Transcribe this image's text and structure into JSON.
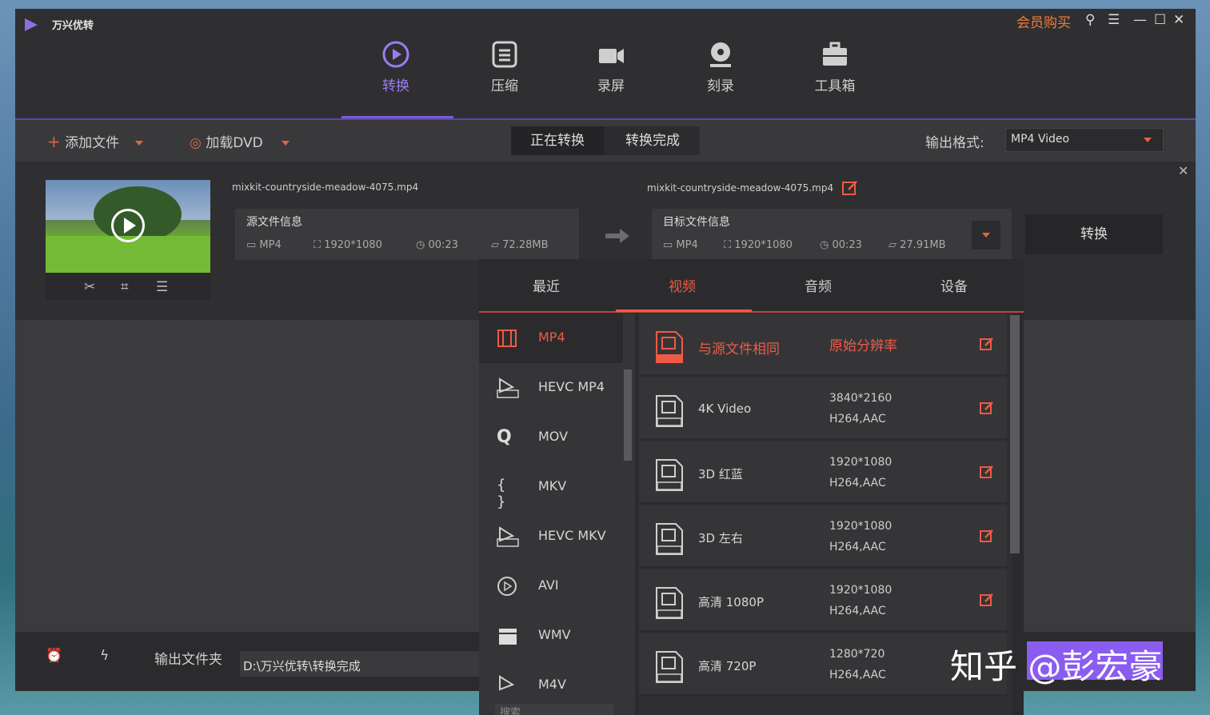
{
  "app": {
    "name": "万兴优转",
    "vip": "会员购买"
  },
  "nav": [
    {
      "label": "转换",
      "icon": "convert-icon",
      "active": true
    },
    {
      "label": "压缩",
      "icon": "compress-icon"
    },
    {
      "label": "录屏",
      "icon": "camera-icon"
    },
    {
      "label": "刻录",
      "icon": "disc-icon"
    },
    {
      "label": "工具箱",
      "icon": "toolbox-icon"
    }
  ],
  "toolbar": {
    "add_file": "添加文件",
    "load_dvd": "加载DVD",
    "seg_converting": "正在转换",
    "seg_done": "转换完成",
    "output_format_label": "输出格式:",
    "output_format_value": "MP4 Video"
  },
  "file": {
    "source_name": "mixkit-countryside-meadow-4075.mp4",
    "target_name": "mixkit-countryside-meadow-4075.mp4",
    "source": {
      "title": "源文件信息",
      "format": "MP4",
      "resolution": "1920*1080",
      "duration": "00:23",
      "size": "72.28MB"
    },
    "target": {
      "title": "目标文件信息",
      "format": "MP4",
      "resolution": "1920*1080",
      "duration": "00:23",
      "size": "27.91MB"
    },
    "convert_button": "转换"
  },
  "bottom": {
    "output_folder_label": "输出文件夹",
    "output_path": "D:\\万兴优转\\转换完成"
  },
  "panel": {
    "tabs": [
      "最近",
      "视频",
      "音频",
      "设备"
    ],
    "active_tab": 1,
    "formats": [
      {
        "label": "MP4",
        "selected": true
      },
      {
        "label": "HEVC MP4"
      },
      {
        "label": "MOV"
      },
      {
        "label": "MKV"
      },
      {
        "label": "HEVC MKV"
      },
      {
        "label": "AVI"
      },
      {
        "label": "WMV"
      },
      {
        "label": "M4V"
      }
    ],
    "presets": [
      {
        "name": "与源文件相同",
        "res": "原始分辨率",
        "codec": "",
        "tag": "SOURCE",
        "selected": true
      },
      {
        "name": "4K Video",
        "res": "3840*2160",
        "codec": "H264,AAC",
        "tag": "4K"
      },
      {
        "name": "3D 红蓝",
        "res": "1920*1080",
        "codec": "H264,AAC",
        "tag": "3D RB"
      },
      {
        "name": "3D 左右",
        "res": "1920*1080",
        "codec": "H264,AAC",
        "tag": "3D LR"
      },
      {
        "name": "高清 1080P",
        "res": "1920*1080",
        "codec": "H264,AAC",
        "tag": "1080P"
      },
      {
        "name": "高清 720P",
        "res": "1280*720",
        "codec": "H264,AAC",
        "tag": "720P"
      }
    ],
    "search_placeholder": "搜索"
  },
  "watermark": {
    "text": "知乎 @彭宏豪"
  },
  "colors": {
    "accent_purple": "#7b5bd6",
    "accent_orange": "#f05a45",
    "vip_orange": "#f07c3a"
  }
}
